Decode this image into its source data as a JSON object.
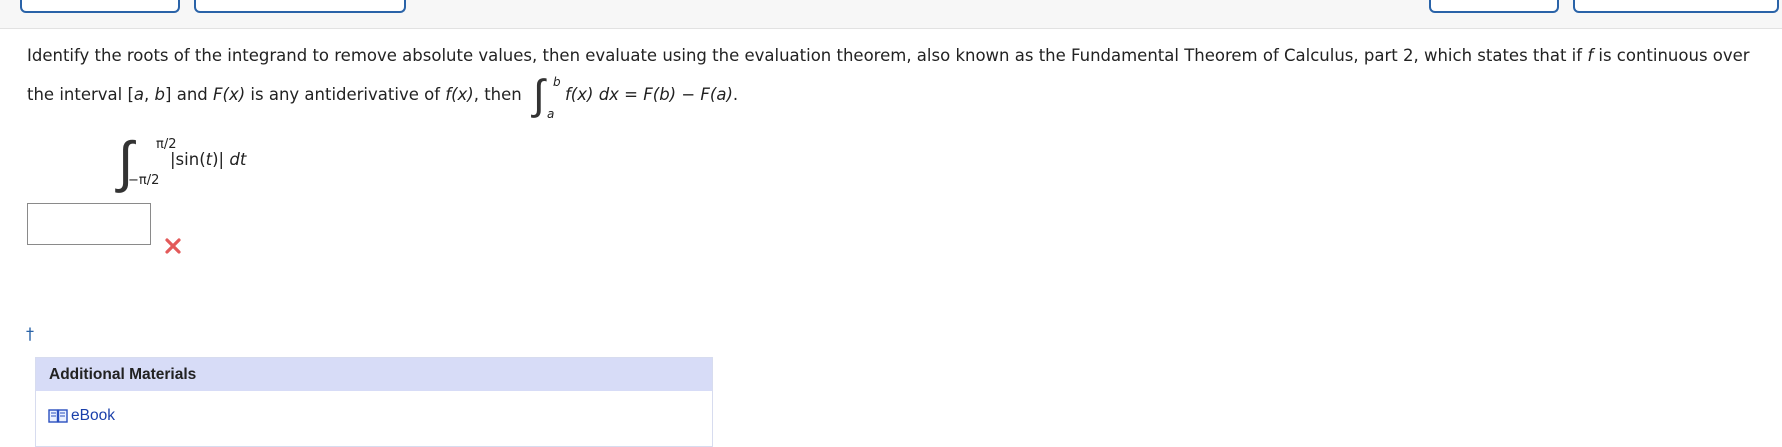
{
  "question": {
    "part1": "Identify the roots of the integrand to remove absolute values, then evaluate using the evaluation theorem, also known as the Fundamental Theorem of Calculus, part 2, which states that if ",
    "f_var": "f",
    "part2": " is continuous over the interval [",
    "a_var": "a",
    "comma": ", ",
    "b_var": "b",
    "part3": "] and ",
    "Fx": "F(x)",
    "part4": " is any antiderivative of ",
    "fx": "f(x)",
    "part5": ", then ",
    "int_upper": "b",
    "int_lower": "a",
    "integrand": "f(x) dx",
    "equals": " = ",
    "result": "F(b) − F(a)",
    "period": "."
  },
  "problem": {
    "upper_limit": "π/2",
    "lower_limit": "−π/2",
    "integrand_text": "|sin(",
    "integrand_var": "t",
    "integrand_close": ")|",
    "differential": "dt"
  },
  "answer": {
    "value": "",
    "status_icon": "close-icon",
    "status_color": "#e35a5a"
  },
  "footnote": {
    "symbol": "†"
  },
  "additional_materials": {
    "title": "Additional Materials",
    "items": [
      {
        "label": "eBook",
        "icon": "book-icon"
      }
    ]
  }
}
